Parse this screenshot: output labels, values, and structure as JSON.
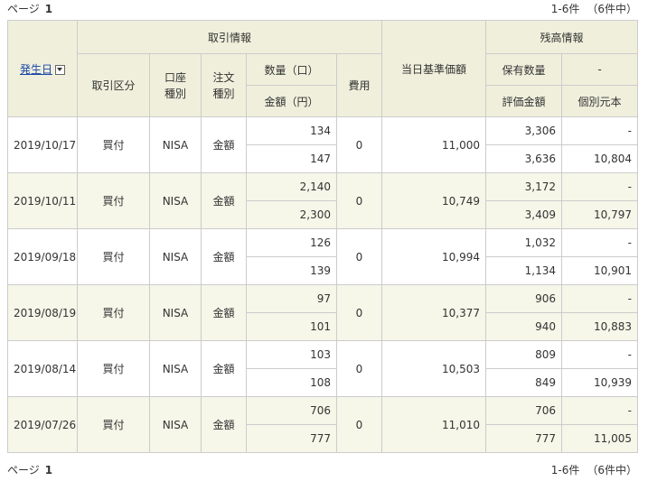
{
  "pager": {
    "page_label": "ページ",
    "page_number": "1",
    "range": "1-6件",
    "total": "（6件中）"
  },
  "header": {
    "date_col": "発生日",
    "trade_info": "取引情報",
    "trade_type": "取引区分",
    "account_type": "口座\n種別",
    "order_type": "注文\n種別",
    "quantity": "数量（口）",
    "amount": "金額（円）",
    "fee": "費用",
    "base_price": "当日基準価額",
    "balance_info": "残高情報",
    "holding_qty": "保有数量",
    "holding_dash": "-",
    "valuation": "評価金額",
    "principal": "個別元本"
  },
  "rows": [
    {
      "date": "2019/10/17",
      "type": "買付",
      "account": "NISA",
      "order": "金額",
      "qty": "134",
      "amount": "147",
      "fee": "0",
      "price": "11,000",
      "hold_qty": "3,306",
      "hold_dash": "-",
      "valuation": "3,636",
      "principal": "10,804"
    },
    {
      "date": "2019/10/11",
      "type": "買付",
      "account": "NISA",
      "order": "金額",
      "qty": "2,140",
      "amount": "2,300",
      "fee": "0",
      "price": "10,749",
      "hold_qty": "3,172",
      "hold_dash": "-",
      "valuation": "3,409",
      "principal": "10,797"
    },
    {
      "date": "2019/09/18",
      "type": "買付",
      "account": "NISA",
      "order": "金額",
      "qty": "126",
      "amount": "139",
      "fee": "0",
      "price": "10,994",
      "hold_qty": "1,032",
      "hold_dash": "-",
      "valuation": "1,134",
      "principal": "10,901"
    },
    {
      "date": "2019/08/19",
      "type": "買付",
      "account": "NISA",
      "order": "金額",
      "qty": "97",
      "amount": "101",
      "fee": "0",
      "price": "10,377",
      "hold_qty": "906",
      "hold_dash": "-",
      "valuation": "940",
      "principal": "10,883"
    },
    {
      "date": "2019/08/14",
      "type": "買付",
      "account": "NISA",
      "order": "金額",
      "qty": "103",
      "amount": "108",
      "fee": "0",
      "price": "10,503",
      "hold_qty": "809",
      "hold_dash": "-",
      "valuation": "849",
      "principal": "10,939"
    },
    {
      "date": "2019/07/26",
      "type": "買付",
      "account": "NISA",
      "order": "金額",
      "qty": "706",
      "amount": "777",
      "fee": "0",
      "price": "11,010",
      "hold_qty": "706",
      "hold_dash": "-",
      "valuation": "777",
      "principal": "11,005"
    }
  ]
}
